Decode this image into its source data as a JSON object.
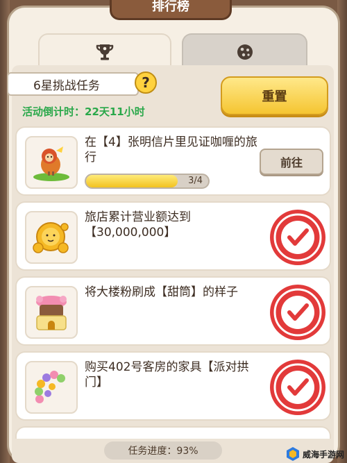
{
  "window": {
    "title": "排行榜"
  },
  "tabs": [
    {
      "icon": "trophy-icon",
      "active": true
    },
    {
      "icon": "cookie-icon",
      "active": false
    }
  ],
  "task_header": {
    "label": "6星挑战任务",
    "help_icon": "question-icon",
    "countdown": "活动倒计时：22天11小时",
    "reset_label": "重置"
  },
  "tasks": [
    {
      "text": "在【4】张明信片里见证咖喱的旅行",
      "icon": "chicken-hero-icon",
      "action_label": "前往",
      "progress_text": "3/4",
      "progress_fraction": 0.75,
      "completed": false
    },
    {
      "text": "旅店累计营业额达到【30,000,000】",
      "icon": "gold-coins-icon",
      "completed": true
    },
    {
      "text": "将大楼粉刷成【甜筒】的样子",
      "icon": "cone-building-icon",
      "completed": true
    },
    {
      "text": "购买402号客房的家具【派对拱门】",
      "icon": "balloon-arch-icon",
      "completed": true
    }
  ],
  "footer": {
    "progress_label": "任务进度：93%",
    "progress_percent": 93
  },
  "watermark": {
    "text": "威海手游网"
  },
  "colors": {
    "stamp_red": "#e23a3a",
    "accent_yellow": "#f5c531",
    "countdown_green": "#2aa84a"
  }
}
